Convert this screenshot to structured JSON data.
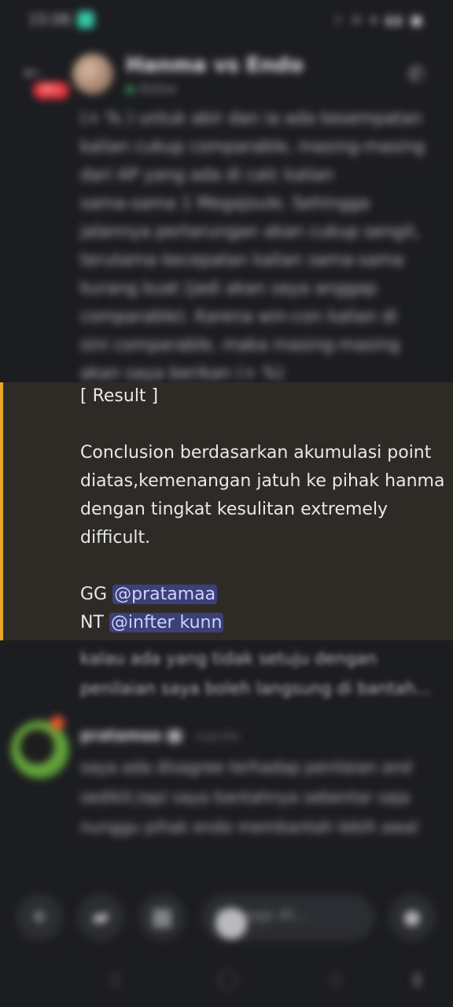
{
  "status_bar": {
    "time": "15:06",
    "system_icons": "⚡ ✕ ▾ ▮▮ ■"
  },
  "header": {
    "back_icon": "arrow-left-icon",
    "unread_badge": "99+",
    "title": "Hanma vs Endo",
    "title_chevron": "›",
    "subtitle": "Online",
    "call_icon": "phone-icon"
  },
  "blurred_message": {
    "lines": [
      "(+ % ) untuk abir dan ia ada kesempatan",
      "kalian cukup comparable, masing-masing",
      "dari AP yang ada di calc kalian",
      "sama-sama 1 Megajoule. Sehingga",
      "jalannya pertarungan akan cukup sengit,",
      "terutama kecepatan kalian sama-sama",
      "kurang kuat (jadi akan saya anggap",
      "comparable). Karena win-con kalian di",
      "sini comparable, maka masing-masing",
      "akan saya berikan (+ %)"
    ]
  },
  "highlighted_message": {
    "result_label": "[ Result ]",
    "conclusion_lines": [
      "Conclusion berdasarkan akumulasi point",
      "diatas,kemenangan jatuh ke pihak hanma",
      "dengan tingkat kesulitan extremely",
      "difficult."
    ],
    "gg_prefix": "GG",
    "gg_mention": "@pratamaa",
    "nt_prefix": "NT",
    "nt_mention": "@infter kunn"
  },
  "after_lines": [
    "kalau ada yang tidak setuju dengan",
    "penilaian saya boleh langsung di bantah..."
  ],
  "second_message": {
    "author": "pratamaa",
    "time": "Live 0%",
    "lines": [
      "saya ada disagree terhadap penilaian and",
      "sedikit,tapi saya bantahnya sebentar saja",
      "nunggu pihak endo membantah lebih awal"
    ]
  },
  "input_bar": {
    "plus": "+",
    "game_icon": "gamepad-icon",
    "apps_icon": "apps-icon",
    "placeholder": "Message #t...",
    "mic_icon": "microphone-icon"
  }
}
